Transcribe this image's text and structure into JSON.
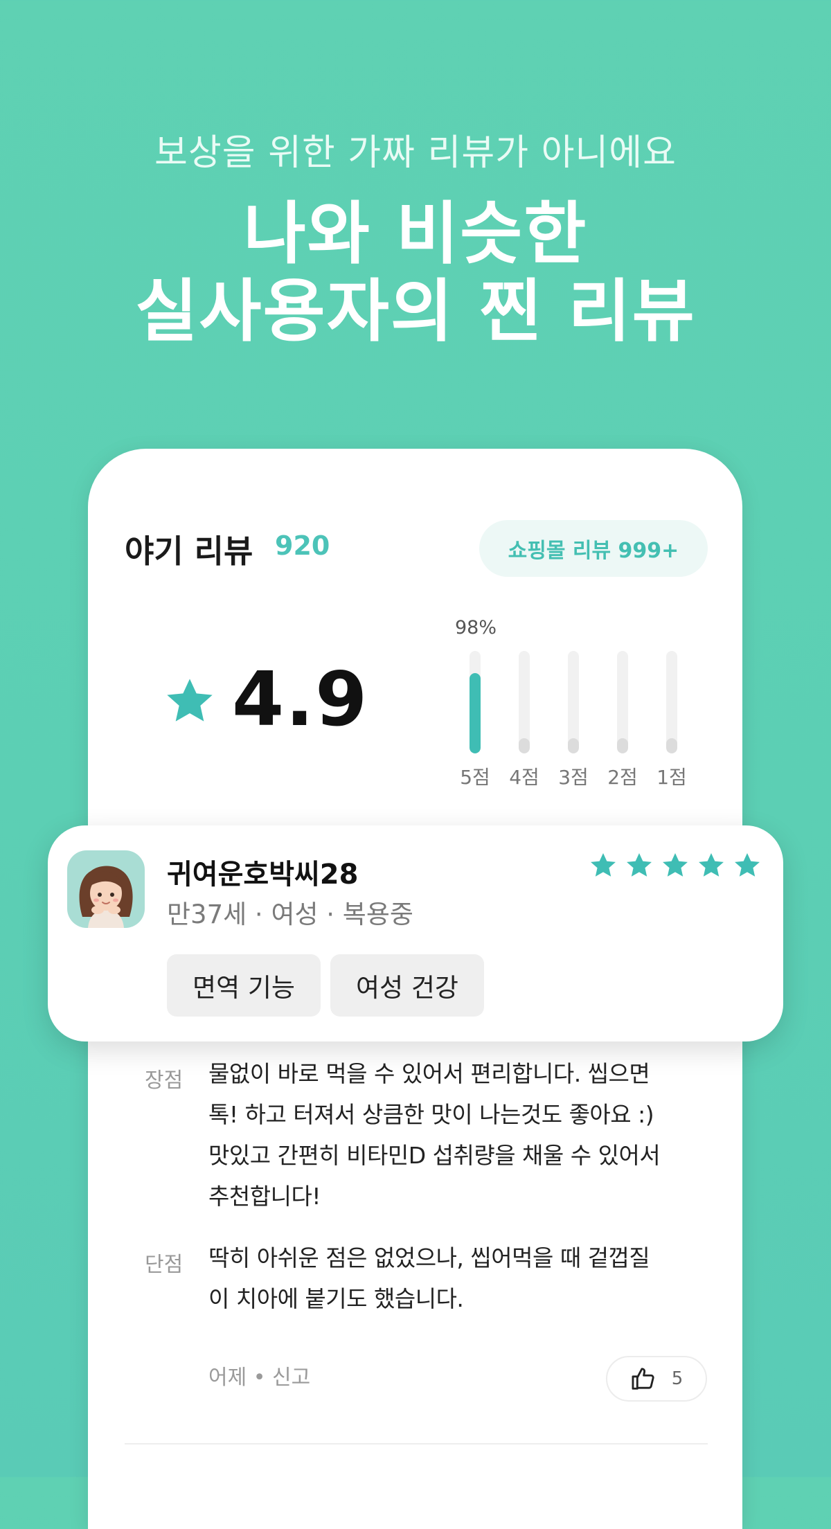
{
  "headline": {
    "subtitle": "보상을 위한 가짜 리뷰가 아니에요",
    "line1": "나와 비슷한",
    "line2": "실사용자의 찐 리뷰"
  },
  "review_header": {
    "title": "야기 리뷰",
    "count": "920",
    "mall_button": "쇼핑몰 리뷰 999+"
  },
  "rating": {
    "value": "4.9",
    "distribution_label": "98%",
    "bars": [
      {
        "label": "5점",
        "fraction": 0.98
      },
      {
        "label": "4점",
        "fraction": 0.02
      },
      {
        "label": "3점",
        "fraction": 0.0
      },
      {
        "label": "2점",
        "fraction": 0.0
      },
      {
        "label": "1점",
        "fraction": 0.0
      }
    ],
    "accent_color": "#3fbdb4"
  },
  "review": {
    "reviewer_name": "귀여운호박씨28",
    "reviewer_meta": "만37세 · 여성 · 복용중",
    "stars": 5,
    "tags": [
      "면역 기능",
      "여성 건강"
    ],
    "pros_label": "장점",
    "pros_lines": [
      "물없이 바로 먹을 수 있어서 편리합니다. 씹으면",
      "톡! 하고 터져서 상큼한 맛이 나는것도 좋아요 :)",
      "맛있고 간편히 비타민D 섭취량을 채울 수 있어서",
      "추천합니다!"
    ],
    "cons_label": "단점",
    "cons_lines": [
      "딱히 아쉬운 점은 없었으나, 씹어먹을 때 겉껍질",
      "이 치아에 붙기도 했습니다."
    ],
    "footer_meta": "어제 • 신고",
    "like_count": "5"
  }
}
